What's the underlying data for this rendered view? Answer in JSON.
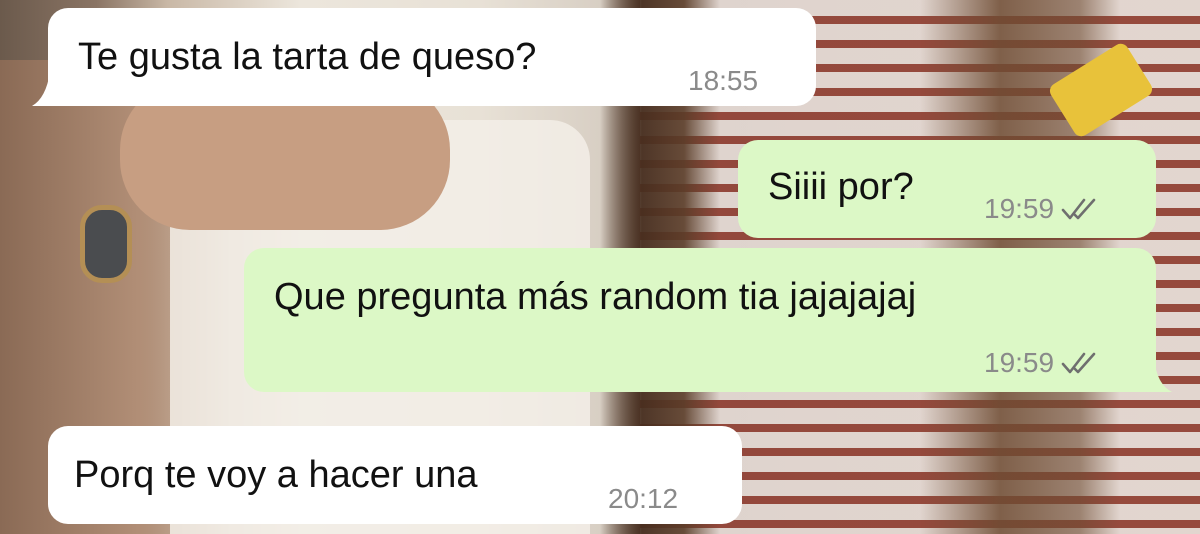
{
  "messages": [
    {
      "direction": "incoming",
      "text": "Te gusta la tarta de queso?",
      "time": "18:55"
    },
    {
      "direction": "outgoing",
      "text": "Siiii por?",
      "time": "19:59",
      "status": "read-double-check"
    },
    {
      "direction": "outgoing",
      "text": "Que pregunta más random tia jajajajaj",
      "time": "19:59",
      "status": "read-double-check"
    },
    {
      "direction": "incoming",
      "text": "Porq te voy a hacer una",
      "time": "20:12"
    }
  ],
  "colors": {
    "incoming_bubble": "#ffffff",
    "outgoing_bubble": "#dcf8c6",
    "timestamp": "#8a8a8a",
    "text": "#111111"
  }
}
